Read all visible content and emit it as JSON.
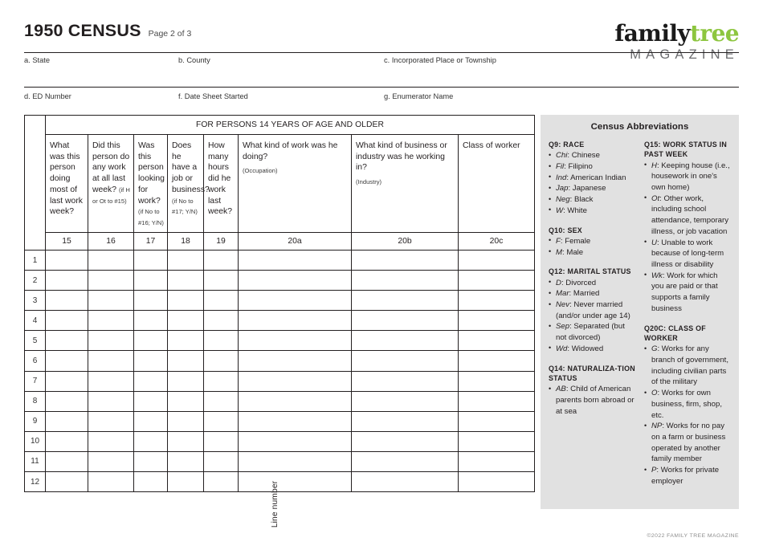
{
  "header": {
    "title": "1950 CENSUS",
    "page_indicator": "Page 2 of 3"
  },
  "logo": {
    "word_family": "family",
    "word_tree": "tree",
    "word_magazine": "MAGAZINE",
    "green": "#8dc63f"
  },
  "identification_fields": [
    {
      "label": "a. State"
    },
    {
      "label": "b. County"
    },
    {
      "label": "c. Incorporated Place or Township"
    },
    {
      "label": "d. ED Number"
    },
    {
      "label": "f. Date Sheet Started"
    },
    {
      "label": "g. Enumerator Name"
    }
  ],
  "table": {
    "line_number_label": "Line number",
    "banner": "FOR PERSONS 14 YEARS OF AGE AND OLDER",
    "columns": [
      {
        "number": "15",
        "question": "What was this person doing most of last work week?",
        "sub": ""
      },
      {
        "number": "16",
        "question": "Did this person do any work at all last week?",
        "sub": "(if H or Ot to #15)"
      },
      {
        "number": "17",
        "question": "Was this person looking for work?",
        "sub": "(if No to #16; Y/N)"
      },
      {
        "number": "18",
        "question": "Does he have a job or business?",
        "sub": "(if No to #17; Y/N)"
      },
      {
        "number": "19",
        "question": "How many hours did he work last week?",
        "sub": ""
      },
      {
        "number": "20a",
        "question": "What kind of work was he doing?",
        "sub": "(Occupation)"
      },
      {
        "number": "20b",
        "question": "What kind of business or industry was he working in?",
        "sub": "(Industry)"
      },
      {
        "number": "20c",
        "question": "Class of worker",
        "sub": ""
      }
    ],
    "row_numbers": [
      "1",
      "2",
      "3",
      "4",
      "5",
      "6",
      "7",
      "8",
      "9",
      "10",
      "11",
      "12"
    ]
  },
  "sidebar": {
    "title": "Census Abbreviations",
    "background": "#e1e1e1",
    "left_column": [
      {
        "heading": "Q9: RACE",
        "items": [
          {
            "abbr": "Chi",
            "text": ": Chinese"
          },
          {
            "abbr": "Fil",
            "text": ": Filipino"
          },
          {
            "abbr": "Ind",
            "text": ": American Indian"
          },
          {
            "abbr": "Jap",
            "text": ": Japanese"
          },
          {
            "abbr": "Neg",
            "text": ": Black"
          },
          {
            "abbr": "W",
            "text": ": White"
          }
        ]
      },
      {
        "heading": "Q10: SEX",
        "items": [
          {
            "abbr": "F",
            "text": ": Female"
          },
          {
            "abbr": "M",
            "text": ": Male"
          }
        ]
      },
      {
        "heading": "Q12: MARITAL STATUS",
        "items": [
          {
            "abbr": "D",
            "text": ": Divorced"
          },
          {
            "abbr": "Mar",
            "text": ": Married"
          },
          {
            "abbr": "Nev",
            "text": ": Never married (and/or under age 14)"
          },
          {
            "abbr": "Sep",
            "text": ": Separated (but not divorced)"
          },
          {
            "abbr": "Wd",
            "text": ": Widowed"
          }
        ]
      },
      {
        "heading": "Q14: NATURALIZA-TION STATUS",
        "items": [
          {
            "abbr": "AB",
            "text": ": Child of American parents born abroad or at sea"
          }
        ]
      }
    ],
    "right_column": [
      {
        "heading": "Q15: WORK STATUS IN PAST WEEK",
        "items": [
          {
            "abbr": "H",
            "text": ": Keeping house (i.e., housework in one's own home)"
          },
          {
            "abbr": "Ot",
            "text": ": Other work, including school attendance, temporary illness, or job vacation"
          },
          {
            "abbr": "U",
            "text": ": Unable to work because of long-term illness or disability"
          },
          {
            "abbr": "Wk",
            "text": ": Work for which you are paid or that supports a family business"
          }
        ]
      },
      {
        "heading": "Q20C: CLASS OF WORKER",
        "items": [
          {
            "abbr": "G",
            "text": ": Works for any branch of government, including civilian parts of the military"
          },
          {
            "abbr": "O",
            "text": ": Works for own business, firm, shop, etc."
          },
          {
            "abbr": "NP",
            "text": ": Works for no pay on a farm or business operated by another family member"
          },
          {
            "abbr": "P",
            "text": ": Works for private employer"
          }
        ]
      }
    ]
  },
  "footer": {
    "copyright": "©2022 FAMILY TREE MAGAZINE"
  }
}
